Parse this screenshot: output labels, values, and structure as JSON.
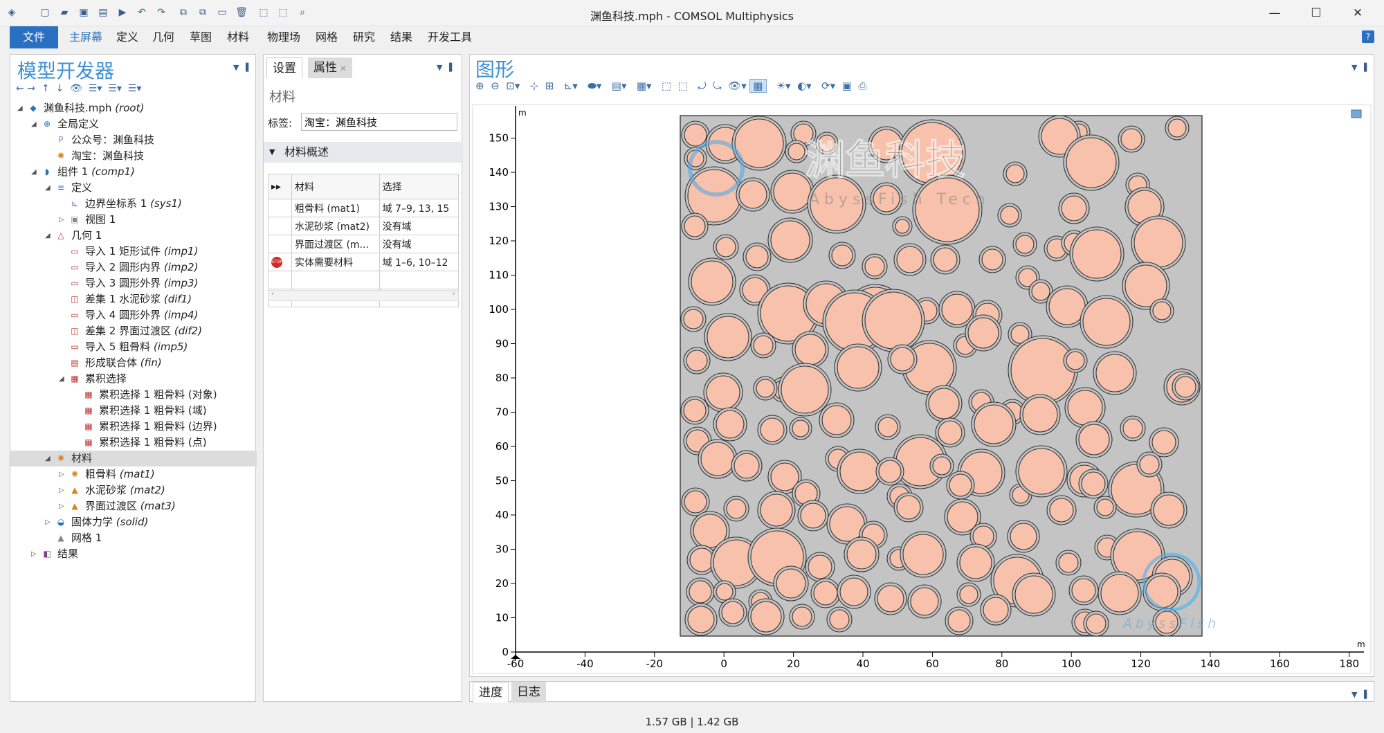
{
  "window": {
    "title": "渊鱼科技.mph - COMSOL Multiphysics",
    "minimize": "—",
    "maximize": "☐",
    "close": "✕"
  },
  "menu": [
    "文件",
    "主屏幕",
    "定义",
    "几何",
    "草图",
    "材料",
    "物理场",
    "网格",
    "研究",
    "结果",
    "开发工具"
  ],
  "help": "?",
  "model_builder": {
    "title": "模型开发器",
    "tree": [
      {
        "level": 0,
        "toggle": "◢",
        "icon": "root",
        "label": "渊鱼科技.mph",
        "tag": "(root)"
      },
      {
        "level": 1,
        "toggle": "◢",
        "icon": "globe",
        "label": "全局定义",
        "tag": ""
      },
      {
        "level": 2,
        "toggle": "",
        "icon": "param",
        "label": "公众号：渊鱼科技",
        "tag": ""
      },
      {
        "level": 2,
        "toggle": "",
        "icon": "mat",
        "label": "淘宝：渊鱼科技",
        "tag": ""
      },
      {
        "level": 1,
        "toggle": "◢",
        "icon": "comp",
        "label": "组件 1",
        "tag": "(comp1)"
      },
      {
        "level": 2,
        "toggle": "◢",
        "icon": "def",
        "label": "定义",
        "tag": ""
      },
      {
        "level": 3,
        "toggle": "",
        "icon": "sys",
        "label": "边界坐标系 1",
        "tag": "(sys1)"
      },
      {
        "level": 3,
        "toggle": "▷",
        "icon": "view",
        "label": "视图 1",
        "tag": ""
      },
      {
        "level": 2,
        "toggle": "◢",
        "icon": "geom",
        "label": "几何 1",
        "tag": ""
      },
      {
        "level": 3,
        "toggle": "",
        "icon": "imp",
        "label": "导入 1 矩形试件",
        "tag": "(imp1)"
      },
      {
        "level": 3,
        "toggle": "",
        "icon": "imp",
        "label": "导入 2 圆形内界",
        "tag": "(imp2)"
      },
      {
        "level": 3,
        "toggle": "",
        "icon": "imp",
        "label": "导入 3 圆形外界",
        "tag": "(imp3)"
      },
      {
        "level": 3,
        "toggle": "",
        "icon": "dif",
        "label": "差集 1 水泥砂浆",
        "tag": "(dif1)"
      },
      {
        "level": 3,
        "toggle": "",
        "icon": "imp",
        "label": "导入 4 圆形外界",
        "tag": "(imp4)"
      },
      {
        "level": 3,
        "toggle": "",
        "icon": "dif",
        "label": "差集 2 界面过渡区",
        "tag": "(dif2)"
      },
      {
        "level": 3,
        "toggle": "",
        "icon": "imp",
        "label": "导入 5 粗骨料",
        "tag": "(imp5)"
      },
      {
        "level": 3,
        "toggle": "",
        "icon": "fin",
        "label": "形成联合体",
        "tag": "(fin)"
      },
      {
        "level": 3,
        "toggle": "◢",
        "icon": "sel",
        "label": "累积选择",
        "tag": ""
      },
      {
        "level": 4,
        "toggle": "",
        "icon": "sel",
        "label": "累积选择 1 粗骨料 (对象)",
        "tag": ""
      },
      {
        "level": 4,
        "toggle": "",
        "icon": "sel",
        "label": "累积选择 1 粗骨料 (域)",
        "tag": ""
      },
      {
        "level": 4,
        "toggle": "",
        "icon": "sel",
        "label": "累积选择 1 粗骨料 (边界)",
        "tag": ""
      },
      {
        "level": 4,
        "toggle": "",
        "icon": "sel",
        "label": "累积选择 1 粗骨料 (点)",
        "tag": ""
      },
      {
        "level": 2,
        "toggle": "◢",
        "icon": "matx",
        "label": "材料",
        "tag": "",
        "selected": true
      },
      {
        "level": 3,
        "toggle": "▷",
        "icon": "mat",
        "label": "粗骨料",
        "tag": "(mat1)"
      },
      {
        "level": 3,
        "toggle": "▷",
        "icon": "matw",
        "label": "水泥砂浆",
        "tag": "(mat2)"
      },
      {
        "level": 3,
        "toggle": "▷",
        "icon": "matw",
        "label": "界面过渡区",
        "tag": "(mat3)"
      },
      {
        "level": 2,
        "toggle": "▷",
        "icon": "solid",
        "label": "固体力学",
        "tag": "(solid)"
      },
      {
        "level": 2,
        "toggle": "",
        "icon": "mesh",
        "label": "网格 1",
        "tag": ""
      },
      {
        "level": 1,
        "toggle": "▷",
        "icon": "res",
        "label": "结果",
        "tag": ""
      }
    ]
  },
  "settings": {
    "tab_settings": "设置",
    "tab_properties": "属性",
    "section": "材料",
    "label_caption": "标签:",
    "label_value": "淘宝：渊鱼科技",
    "overview": "材料概述",
    "col_material": "材料",
    "col_selection": "选择",
    "rows": [
      {
        "material": "粗骨料 (mat1)",
        "selection": "域 7–9, 13, 15",
        "stop": false
      },
      {
        "material": "水泥砂浆 (mat2)",
        "selection": "没有域",
        "stop": false
      },
      {
        "material": "界面过渡区 (m...",
        "selection": "没有域",
        "stop": false
      },
      {
        "material": "实体需要材料",
        "selection": "域 1–6, 10–12",
        "stop": true
      }
    ],
    "stop_text": "STOP"
  },
  "graphics": {
    "title": "图形",
    "unit": "m",
    "watermark_text": "渊鱼科技",
    "watermark_sub": "AbyssFish Tech",
    "watermark_logo": "AbyssFish",
    "x_ticks": [
      "-60",
      "-40",
      "-20",
      "0",
      "20",
      "40",
      "60",
      "80",
      "100",
      "120",
      "140",
      "160",
      "180"
    ],
    "y_ticks": [
      "0",
      "10",
      "20",
      "30",
      "40",
      "50",
      "60",
      "70",
      "80",
      "90",
      "100",
      "110",
      "120",
      "130",
      "140",
      "150"
    ],
    "colors": {
      "aggregate": "#f7c1ac",
      "domain": "#c4c4c4",
      "accent": "#3e8fd6"
    }
  },
  "bottom_tabs": [
    "进度",
    "日志"
  ],
  "status": "1.57 GB | 1.42 GB"
}
